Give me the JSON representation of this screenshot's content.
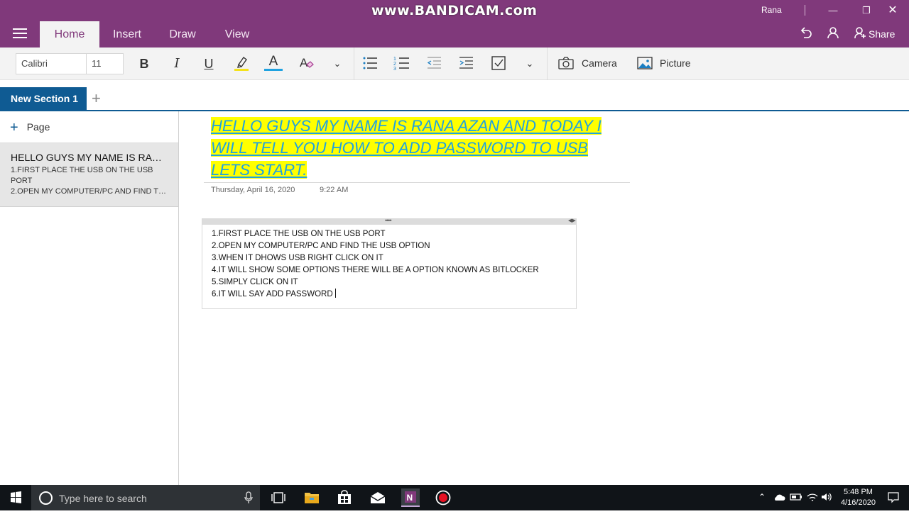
{
  "watermark": "www.BANDICAM.com",
  "user": {
    "name": "Rana"
  },
  "ribbon": {
    "tabs": [
      {
        "label": "Home",
        "active": true
      },
      {
        "label": "Insert",
        "active": false
      },
      {
        "label": "Draw",
        "active": false
      },
      {
        "label": "View",
        "active": false
      }
    ],
    "share_label": "Share",
    "icons": [
      "undo-icon",
      "person-icon",
      "share-person-icon"
    ]
  },
  "toolbar": {
    "font_name": "Calibri",
    "font_size": "11",
    "bold": "B",
    "italic": "I",
    "underline": "U",
    "font_color": "A",
    "camera_label": "Camera",
    "picture_label": "Picture",
    "accent_highlight": "#f4e21b",
    "accent_font_color": "#1fa2e0"
  },
  "section": {
    "name": "New Section 1",
    "color": "#0f5b93"
  },
  "page_list": {
    "add_page_label": "Page",
    "items": [
      {
        "title": "HELLO GUYS MY NAME IS RANA AZAN AND TODAY I WILL TELL YOU HOW TO ADD PASSWORD TO USB LETS START.",
        "preview_1": "1.FIRST PLACE THE USB ON THE USB PORT",
        "preview_2": "2.OPEN MY COMPUTER/PC AND FIND THE USB OPTION"
      }
    ]
  },
  "page": {
    "title": "HELLO GUYS MY NAME IS RANA AZAN AND TODAY I WILL TELL YOU HOW TO ADD PASSWORD TO USB LETS START.",
    "date": "Thursday, April 16, 2020",
    "time": "9:22 AM",
    "note_lines": [
      "1.FIRST PLACE THE USB ON THE USB PORT",
      "2.OPEN MY COMPUTER/PC AND FIND THE USB OPTION",
      "3.WHEN IT DHOWS USB RIGHT CLICK ON IT",
      "4.IT WILL SHOW SOME OPTIONS THERE WILL BE A OPTION KNOWN AS BITLOCKER",
      "5.SIMPLY CLICK ON IT",
      "6.IT WILL SAY ADD PASSWORD"
    ]
  },
  "taskbar": {
    "search_placeholder": "Type here to search",
    "time": "5:48 PM",
    "date": "4/16/2020"
  },
  "colors": {
    "brand": "#80397b",
    "taskbar": "#101418"
  }
}
